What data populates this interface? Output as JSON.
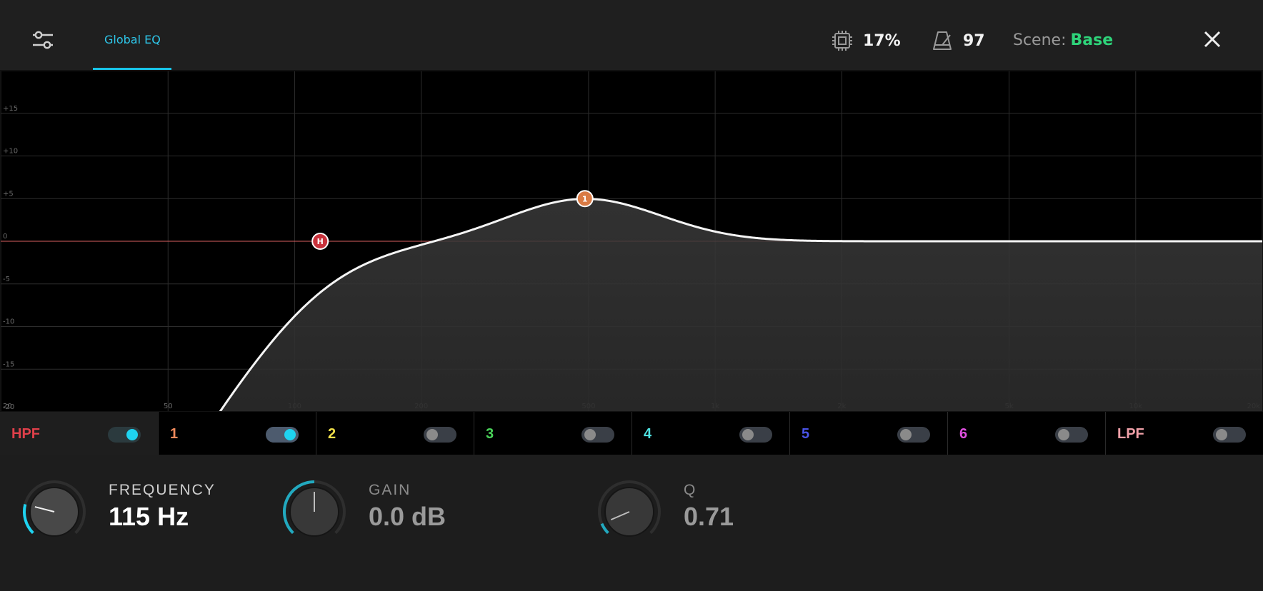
{
  "header": {
    "tab_label": "Global EQ",
    "cpu_value": "17%",
    "tempo_value": "97",
    "scene_label": "Scene:",
    "scene_name": "Base"
  },
  "graph": {
    "y_labels": [
      "+15",
      "+10",
      "+5",
      "0",
      "-5",
      "-10",
      "-15",
      "-20"
    ],
    "x_labels": [
      "20",
      "50",
      "100",
      "200",
      "500",
      "1k",
      "2k",
      "5k",
      "10k",
      "20k"
    ],
    "nodes": [
      {
        "label": "H",
        "freq": 115,
        "gain": 0,
        "color": "#c8323c"
      },
      {
        "label": "1",
        "freq": 490,
        "gain": 5,
        "color": "#d97a44"
      }
    ]
  },
  "bands": [
    {
      "label": "HPF",
      "color": "#e0404a",
      "on": true,
      "active": true
    },
    {
      "label": "1",
      "color": "#f08a5c",
      "on": true
    },
    {
      "label": "2",
      "color": "#f2e04a",
      "on": false
    },
    {
      "label": "3",
      "color": "#4ad45a",
      "on": false
    },
    {
      "label": "4",
      "color": "#4fe0e0",
      "on": false
    },
    {
      "label": "5",
      "color": "#4a54e8",
      "on": false
    },
    {
      "label": "6",
      "color": "#e050e0",
      "on": false
    },
    {
      "label": "LPF",
      "color": "#f0a0a8",
      "on": false
    }
  ],
  "params": {
    "frequency": {
      "label": "FREQUENCY",
      "value": "115 Hz",
      "level": 0.22
    },
    "gain": {
      "label": "GAIN",
      "value": "0.0 dB",
      "level": 0.5
    },
    "q": {
      "label": "Q",
      "value": "0.71",
      "level": 0.08
    }
  },
  "colors": {
    "accent": "#1fd3f0",
    "scene": "#2ed47a"
  }
}
